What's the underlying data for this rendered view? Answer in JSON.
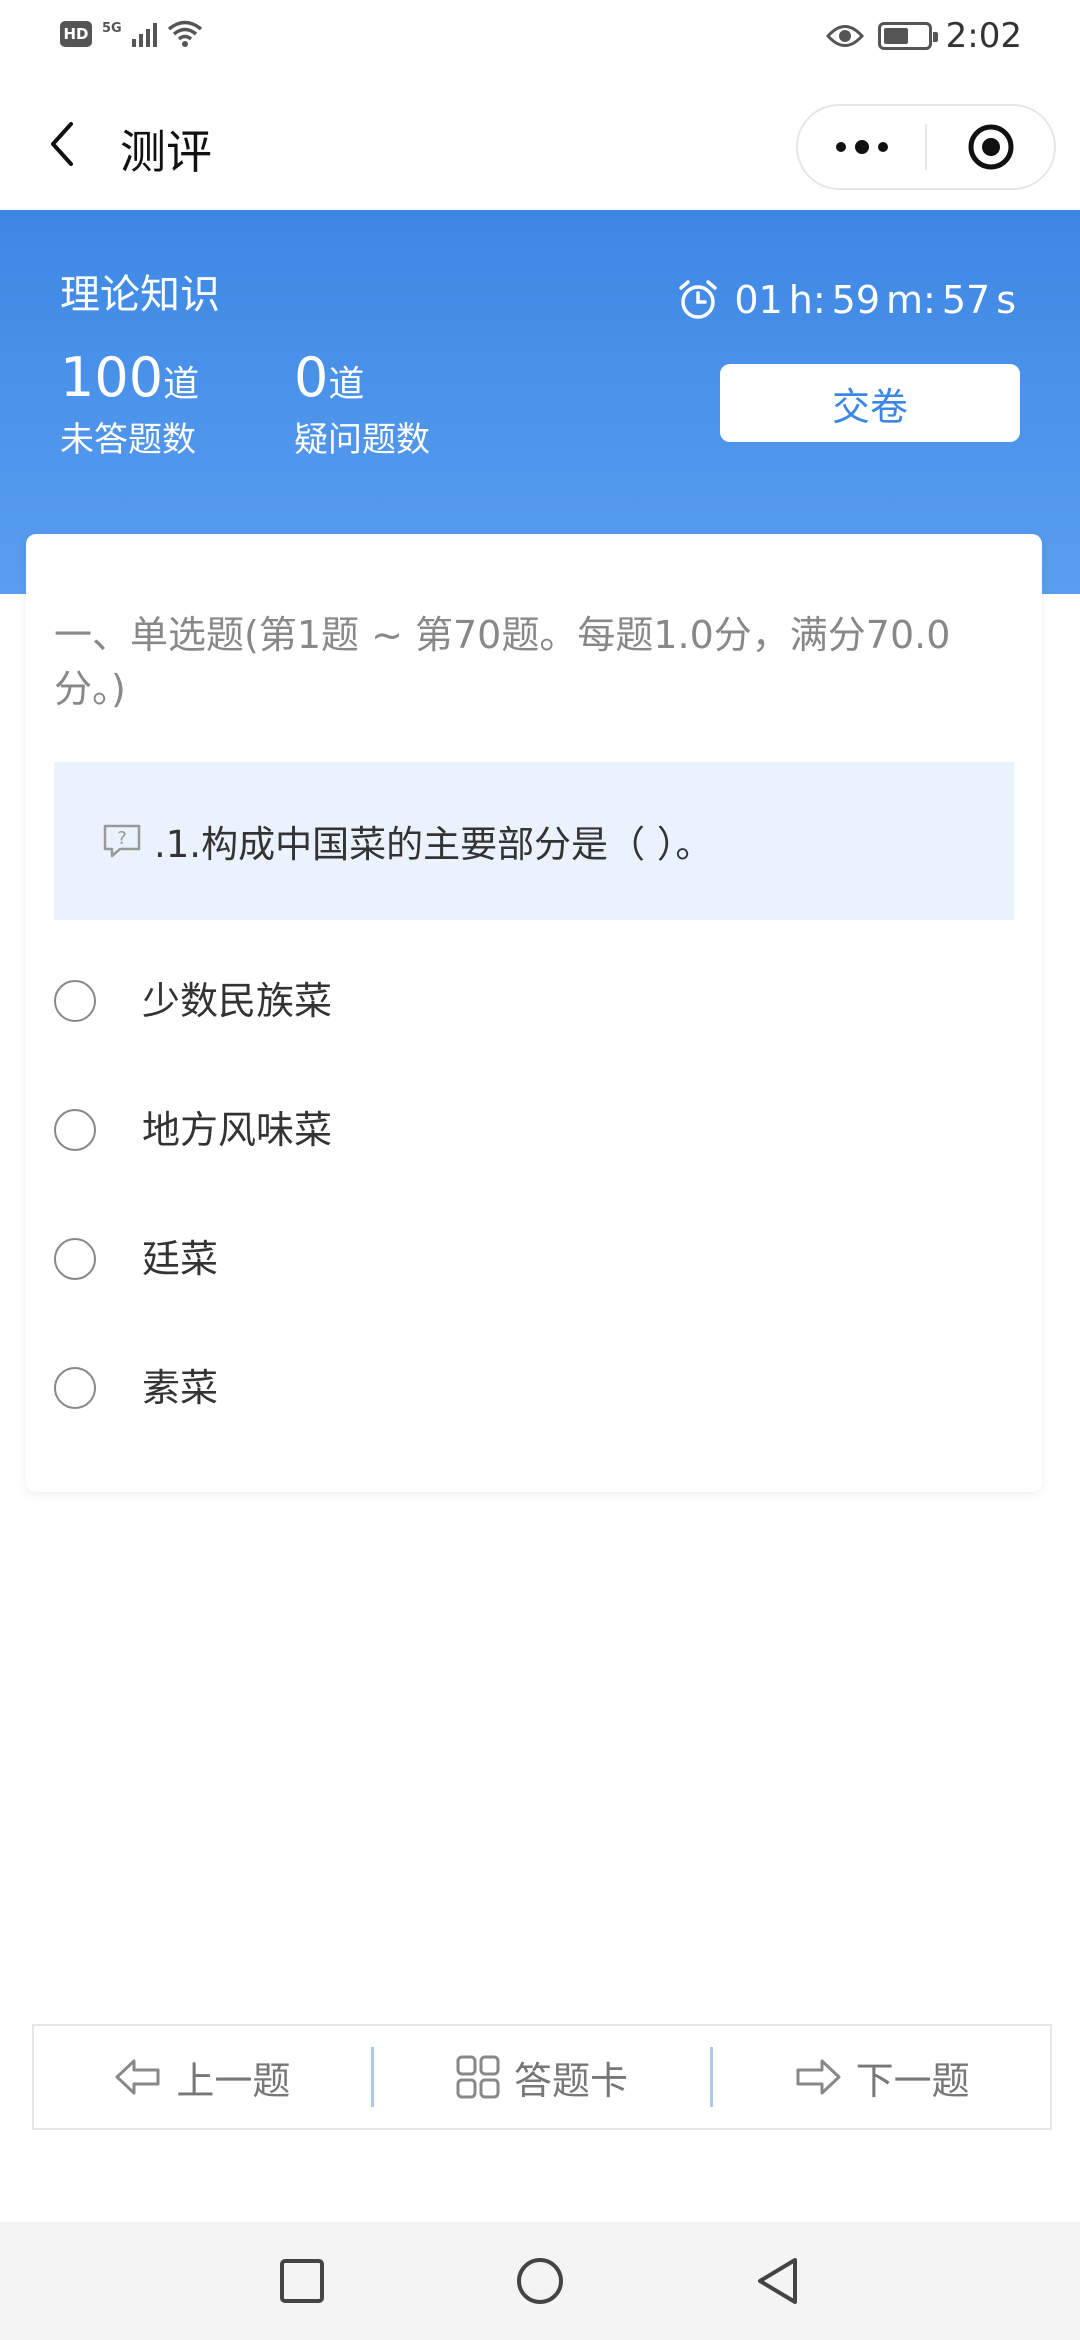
{
  "status_bar": {
    "hd_badge": "HD",
    "network": "5G",
    "time": "2:02"
  },
  "nav": {
    "title": "测评"
  },
  "header": {
    "subject": "理论知识",
    "timer": {
      "hours": "01",
      "h_label": "h:",
      "minutes": "59",
      "m_label": "m:",
      "seconds": "57",
      "s_label": "s"
    },
    "unanswered": {
      "count": "100",
      "unit": "道",
      "label": "未答题数"
    },
    "doubtful": {
      "count": "0",
      "unit": "道",
      "label": "疑问题数"
    },
    "submit_label": "交卷"
  },
  "section": {
    "title": "一、单选题(第1题 ~ 第70题。每题1.0分，满分70.0分。)"
  },
  "question": {
    "text": ".1.构成中国菜的主要部分是（ ）。",
    "options": [
      {
        "label": "少数民族菜"
      },
      {
        "label": "地方风味菜"
      },
      {
        "label": "廷菜"
      },
      {
        "label": "素菜"
      }
    ]
  },
  "bottom_nav": {
    "prev_label": "上一题",
    "card_label": "答题卡",
    "next_label": "下一题"
  },
  "colors": {
    "header_top": "#3d87e4",
    "header_bottom": "#5a9ef0",
    "question_bg": "#eaf2fd",
    "accent": "#3d87e4"
  }
}
